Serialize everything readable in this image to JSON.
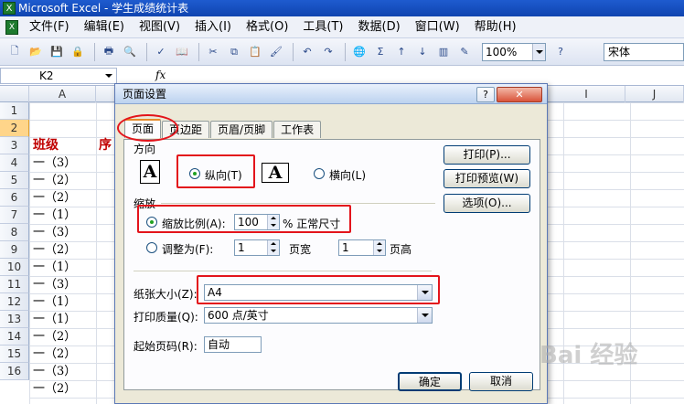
{
  "window": {
    "title": "Microsoft Excel - 学生成绩统计表"
  },
  "menu": [
    "文件(F)",
    "编辑(E)",
    "视图(V)",
    "插入(I)",
    "格式(O)",
    "工具(T)",
    "数据(D)",
    "窗口(W)",
    "帮助(H)"
  ],
  "toolbar": {
    "zoom": "100%",
    "font": "宋体"
  },
  "formula_bar": {
    "cell_ref": "K2",
    "fx": "fx"
  },
  "sheet": {
    "columns": [
      "A",
      "I",
      "J"
    ],
    "rows": [
      "1",
      "2",
      "3",
      "4",
      "5",
      "6",
      "7",
      "8",
      "9",
      "10",
      "11",
      "12",
      "13",
      "14",
      "15",
      "16"
    ],
    "col_a": [
      "",
      "班级",
      "一（3）",
      "一（2）",
      "一（2）",
      "一（1）",
      "一（3）",
      "一（2）",
      "一（1）",
      "一（3）",
      "一（1）",
      "一（1）",
      "一（2）",
      "一（2）",
      "一（3）",
      "一（2）"
    ],
    "col_b_header": "序"
  },
  "dialog": {
    "title": "页面设置",
    "tabs": [
      "页面",
      "页边距",
      "页眉/页脚",
      "工作表"
    ],
    "orientation_section": "方向",
    "portrait_label": "纵向(T)",
    "landscape_label": "横向(L)",
    "orientation_icon_letter": "A",
    "scaling_section": "缩放",
    "scale_label": "缩放比例(A):",
    "scale_value": "100",
    "scale_suffix": "% 正常尺寸",
    "fit_label": "调整为(F):",
    "fit_wide_value": "1",
    "fit_wide_suffix": "页宽",
    "fit_tall_value": "1",
    "fit_tall_suffix": "页高",
    "paper_size_label": "纸张大小(Z):",
    "paper_size_value": "A4",
    "print_quality_label": "打印质量(Q):",
    "print_quality_value": "600 点/英寸",
    "first_page_label": "起始页码(R):",
    "first_page_value": "自动",
    "btn_print": "打印(P)...",
    "btn_preview": "打印预览(W)",
    "btn_options": "选项(O)...",
    "btn_ok": "确定",
    "btn_cancel": "取消",
    "help_btn": "?",
    "close_btn": "✕"
  },
  "watermark": "Bai 经验"
}
